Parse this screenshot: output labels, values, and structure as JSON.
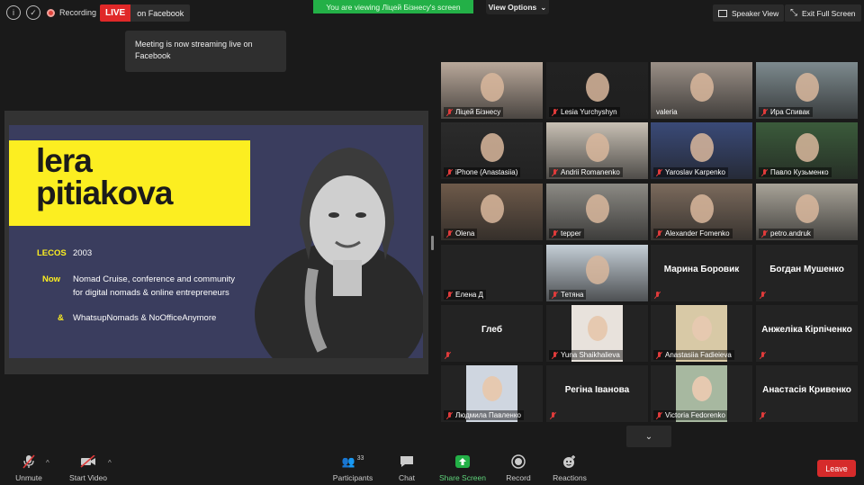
{
  "topbar": {
    "recording_label": "Recording",
    "live_badge": "LIVE",
    "live_target": "on Facebook",
    "viewing_banner": "You are viewing Ліцей Бізнесу's screen",
    "view_options_label": "View Options",
    "speaker_view_label": "Speaker View",
    "exit_full_screen_label": "Exit Full Screen"
  },
  "tooltip": {
    "text": "Meeting is now streaming live on Facebook"
  },
  "slide": {
    "title_line1": "lera",
    "title_line2": "pitiakova",
    "rows": [
      {
        "key": "LECOS",
        "value": "2003"
      },
      {
        "key": "Now",
        "value": "Nomad Cruise, conference and community",
        "value2": "for digital nomads & online entrepreneurs"
      },
      {
        "key": "&",
        "value": "WhatsupNomads & NoOfficeAnymore"
      }
    ]
  },
  "gallery": {
    "tiles": [
      {
        "name": "Ліцей Бізнесу",
        "type": "video",
        "color": "#b9a89a"
      },
      {
        "name": "Lesia Yurchyshyn",
        "type": "video",
        "color": "#222222"
      },
      {
        "name": "valeria",
        "type": "video",
        "color": "#9a8f86",
        "active": true
      },
      {
        "name": "Ира Спивак",
        "type": "video",
        "color": "#7d8a8e"
      },
      {
        "name": "iPhone (Anastasiia)",
        "type": "video",
        "color": "#2b2b2b"
      },
      {
        "name": "Andrii Romanenko",
        "type": "video",
        "color": "#c8c0b4"
      },
      {
        "name": "Yaroslav Karpenko",
        "type": "video",
        "color": "#3a4a78"
      },
      {
        "name": "Павло Кузьменко",
        "type": "video",
        "color": "#3b5b3b"
      },
      {
        "name": "Olena",
        "type": "video",
        "color": "#6e5a4a"
      },
      {
        "name": "tepper",
        "type": "video",
        "color": "#8c8a84"
      },
      {
        "name": "Alexander Fomenko",
        "type": "video",
        "color": "#7b6a5c"
      },
      {
        "name": "petro.andruk",
        "type": "video",
        "color": "#a8a398"
      },
      {
        "name": "Елена Д",
        "type": "muted-only",
        "color": "#232323"
      },
      {
        "name": "Тетяна",
        "type": "video",
        "color": "#c4ced6"
      },
      {
        "name": "Марина Боровик",
        "type": "name"
      },
      {
        "name": "Богдан Мушенко",
        "type": "name"
      },
      {
        "name": "Глеб",
        "type": "name"
      },
      {
        "name": "Yuna Shaikhalieva",
        "type": "photo",
        "color": "#e8e2dc"
      },
      {
        "name": "Anastasiia Fadieieva",
        "type": "photo",
        "color": "#d8c9a6"
      },
      {
        "name": "Анжеліка Кірпіченко",
        "type": "name"
      },
      {
        "name": "Людмила Павленко",
        "type": "photo",
        "color": "#cfd6e0"
      },
      {
        "name": "Регіна Іванова",
        "type": "name"
      },
      {
        "name": "Victoria Fedorenko",
        "type": "photo",
        "color": "#a7b8a0"
      },
      {
        "name": "Анастасія Кривенко",
        "type": "name"
      }
    ]
  },
  "toolbar": {
    "unmute_label": "Unmute",
    "start_video_label": "Start Video",
    "participants_label": "Participants",
    "participants_count": "33",
    "chat_label": "Chat",
    "share_screen_label": "Share Screen",
    "record_label": "Record",
    "reactions_label": "Reactions",
    "leave_label": "Leave"
  }
}
